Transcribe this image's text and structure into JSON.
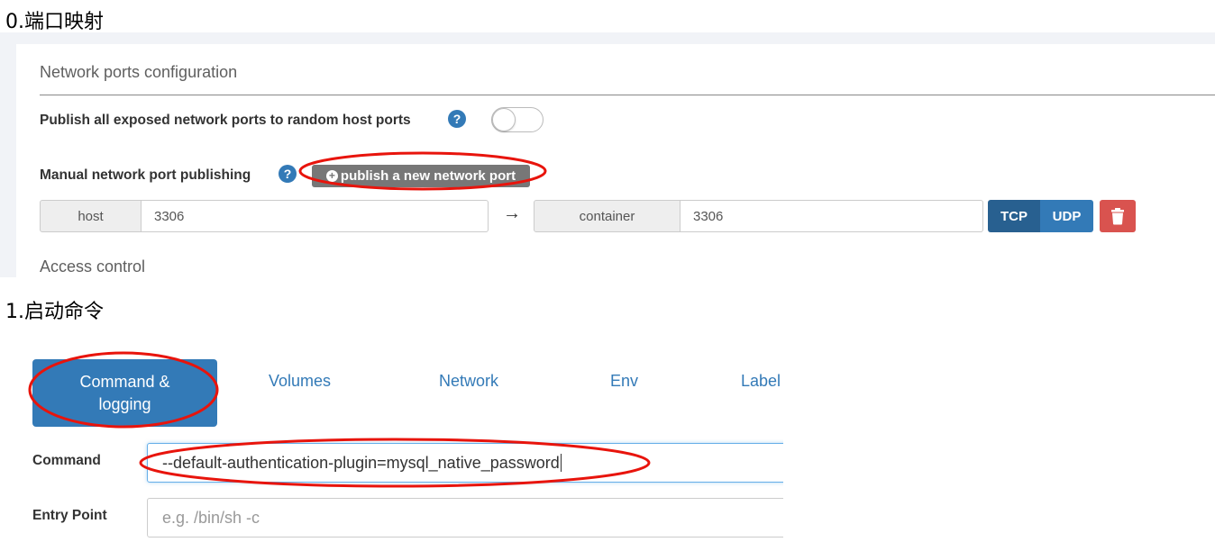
{
  "section0": {
    "title": "0.端口映射",
    "network_ports_title": "Network ports configuration",
    "publish_all_label": "Publish all exposed network ports to random host ports",
    "publish_all_help": "?",
    "publish_all_enabled": false,
    "manual_label": "Manual network port publishing",
    "manual_help": "?",
    "publish_button_label": "publish a new network port",
    "port_mapping": {
      "host_label": "host",
      "host_value": "3306",
      "arrow": "→",
      "container_label": "container",
      "container_value": "3306",
      "tcp_label": "TCP",
      "udp_label": "UDP",
      "selected_protocol": "TCP"
    },
    "access_control_title": "Access control"
  },
  "section1": {
    "title": "1.启动命令",
    "tabs": [
      {
        "label": "Command &\nlogging",
        "active": true
      },
      {
        "label": "Volumes"
      },
      {
        "label": "Network"
      },
      {
        "label": "Env"
      },
      {
        "label": "Label"
      }
    ],
    "command_label": "Command",
    "command_value": "--default-authentication-plugin=mysql_native_password",
    "entry_point_label": "Entry Point",
    "entry_point_placeholder": "e.g. /bin/sh -c"
  },
  "colors": {
    "primary": "#337ab7",
    "primary_dark": "#286090",
    "danger": "#d9534f",
    "annotation": "#e8140c",
    "muted_button": "#777777"
  }
}
